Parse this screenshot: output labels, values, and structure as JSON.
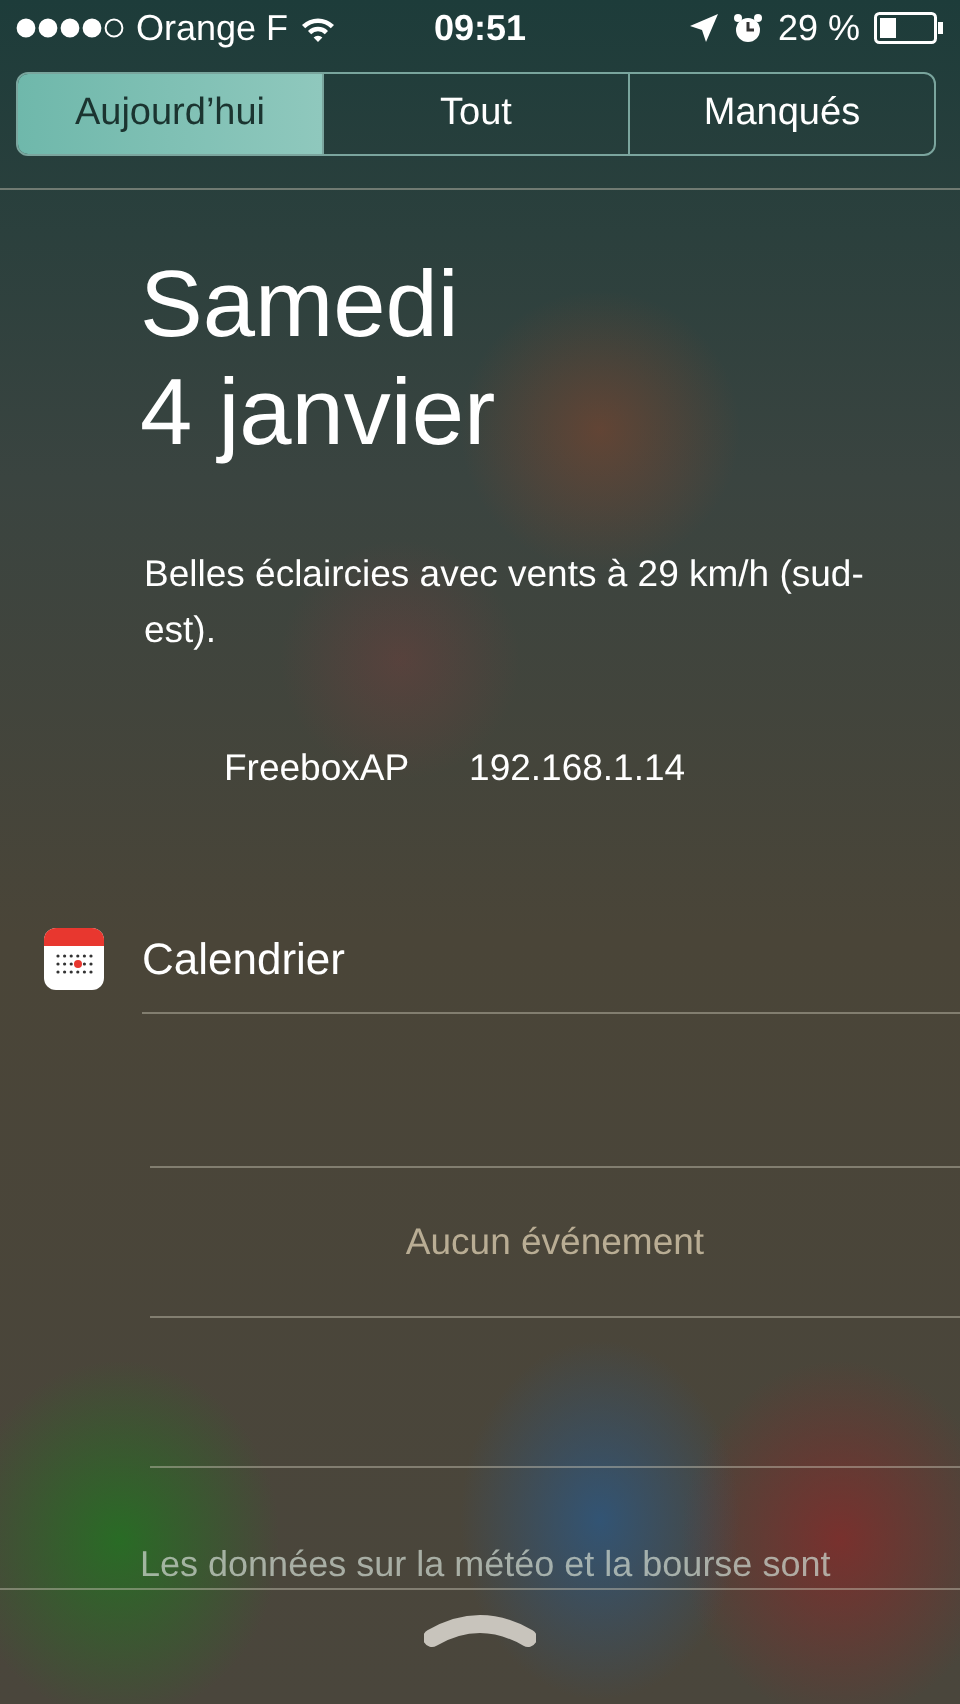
{
  "status_bar": {
    "carrier": "Orange F",
    "time": "09:51",
    "battery": "29 %"
  },
  "tabs": [
    {
      "label": "Aujourd’hui",
      "selected": true
    },
    {
      "label": "Tout",
      "selected": false
    },
    {
      "label": "Manqués",
      "selected": false
    }
  ],
  "date": {
    "weekday": "Samedi",
    "day": "4 janvier"
  },
  "weather": "Belles éclaircies avec vents à 29 km/h (sud-est).",
  "network": {
    "name": "FreeboxAP",
    "address": "192.168.1.14"
  },
  "calendar": {
    "title": "Calendrier",
    "empty_message": "Aucun événement"
  },
  "footer": "Les données sur la météo et la bourse sont"
}
